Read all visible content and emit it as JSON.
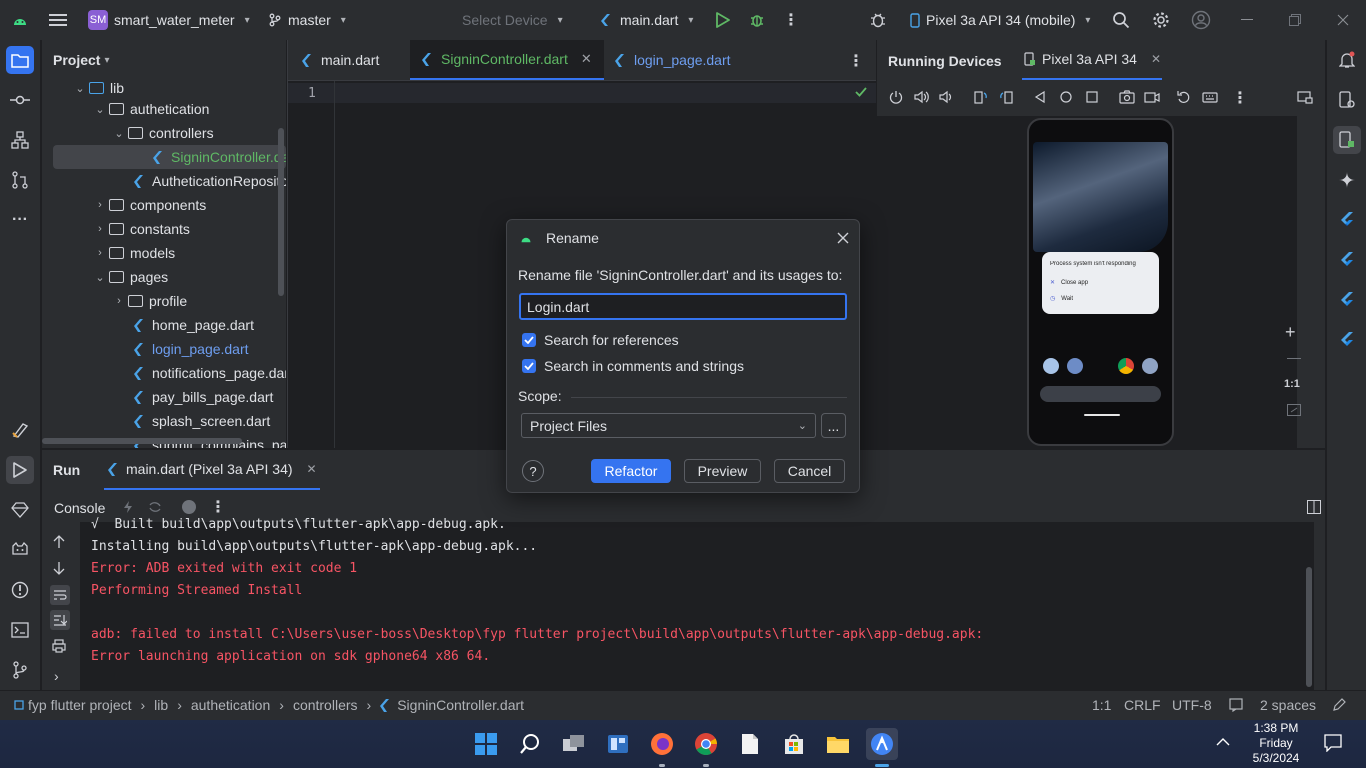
{
  "titlebar": {
    "project_badge": "SM",
    "project_name": "smart_water_meter",
    "branch": "master",
    "device_select": "Select Device",
    "run_config": "main.dart",
    "running_device": "Pixel 3a API 34 (mobile)"
  },
  "project_panel": {
    "title": "Project",
    "items": [
      {
        "label": "lib",
        "type": "folder",
        "expanded": true
      },
      {
        "label": "authetication",
        "type": "folder",
        "expanded": true
      },
      {
        "label": "controllers",
        "type": "folder",
        "expanded": true
      },
      {
        "label": "SigninController.dart",
        "type": "dart",
        "selected": true
      },
      {
        "label": "AutheticationRepository.dart",
        "type": "dart"
      },
      {
        "label": "components",
        "type": "folder",
        "expanded": false
      },
      {
        "label": "constants",
        "type": "folder",
        "expanded": false
      },
      {
        "label": "models",
        "type": "folder",
        "expanded": false
      },
      {
        "label": "pages",
        "type": "folder",
        "expanded": true
      },
      {
        "label": "profile",
        "type": "folder",
        "expanded": false
      },
      {
        "label": "home_page.dart",
        "type": "dart"
      },
      {
        "label": "login_page.dart",
        "type": "dart"
      },
      {
        "label": "notifications_page.dart",
        "type": "dart"
      },
      {
        "label": "pay_bills_page.dart",
        "type": "dart"
      },
      {
        "label": "splash_screen.dart",
        "type": "dart"
      },
      {
        "label": "submit_complains_page.dart",
        "type": "dart"
      }
    ]
  },
  "editor": {
    "tabs": [
      {
        "label": "main.dart"
      },
      {
        "label": "SigninController.dart",
        "active": true
      },
      {
        "label": "login_page.dart"
      }
    ],
    "line_number": "1"
  },
  "devices_panel": {
    "title": "Running Devices",
    "device_tab": "Pixel 3a API 34",
    "zoom_label": "1:1",
    "phone_dialog_title": "Process system isn't responding",
    "phone_dialog_options": [
      "Close app",
      "Wait"
    ]
  },
  "run_panel": {
    "title": "Run",
    "tab": "main.dart (Pixel 3a API 34)",
    "console_label": "Console",
    "lines": [
      {
        "text": "√  Built build\\app\\outputs\\flutter-apk\\app-debug.apk.",
        "color": "#dfe1e5"
      },
      {
        "text": "Installing build\\app\\outputs\\flutter-apk\\app-debug.apk...",
        "color": "#dfe1e5"
      },
      {
        "text": "Error: ADB exited with exit code 1",
        "color": "#f75464"
      },
      {
        "text": "Performing Streamed Install",
        "color": "#f75464"
      },
      {
        "text": "",
        "color": "#f75464"
      },
      {
        "text": "adb: failed to install C:\\Users\\user-boss\\Desktop\\fyp flutter project\\build\\app\\outputs\\flutter-apk\\app-debug.apk:",
        "color": "#f75464"
      },
      {
        "text": "Error launching application on sdk gphone64 x86 64.",
        "color": "#f75464"
      }
    ]
  },
  "status_bar": {
    "breadcrumb": [
      "fyp flutter project",
      "lib",
      "authetication",
      "controllers",
      "SigninController.dart"
    ],
    "position": "1:1",
    "line_sep": "CRLF",
    "encoding": "UTF-8",
    "indent": "2 spaces"
  },
  "dialog": {
    "title": "Rename",
    "prompt": "Rename file 'SigninController.dart' and its usages to:",
    "input_value": "Login.dart",
    "search_references": "Search for references",
    "search_comments": "Search in comments and strings",
    "scope_label": "Scope:",
    "scope_value": "Project Files",
    "more_button": "...",
    "help": "?",
    "refactor": "Refactor",
    "preview": "Preview",
    "cancel": "Cancel"
  },
  "taskbar": {
    "time": "1:38 PM",
    "day": "Friday",
    "date": "5/3/2024"
  },
  "colors": {
    "accent": "#3574f0",
    "error": "#f75464",
    "dart": "#4aa3e8",
    "selected_file": "#5fb865"
  }
}
